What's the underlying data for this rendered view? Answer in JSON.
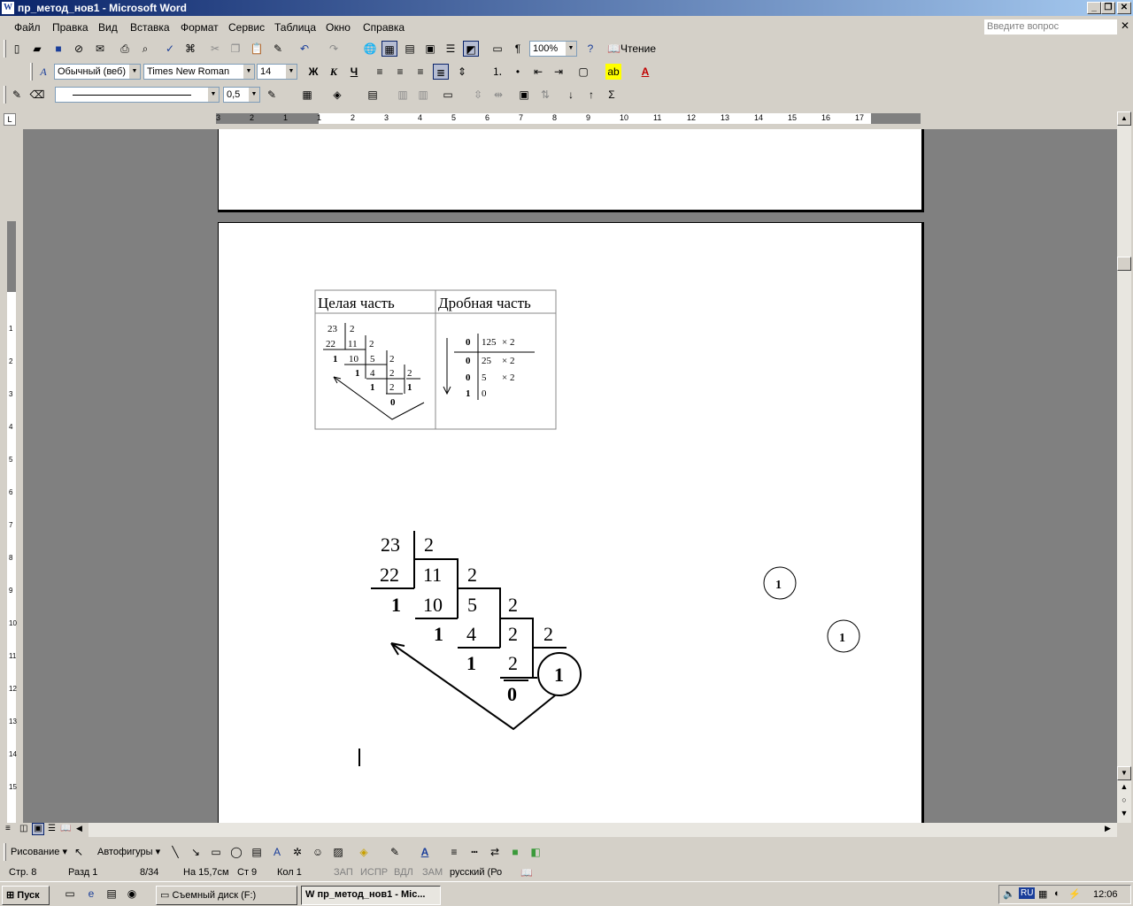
{
  "window": {
    "title": "пр_метод_нов1 - Microsoft Word",
    "app_icon": "W"
  },
  "menu": {
    "items": [
      "Файл",
      "Правка",
      "Вид",
      "Вставка",
      "Формат",
      "Сервис",
      "Таблица",
      "Окно",
      "Справка"
    ],
    "help_placeholder": "Введите вопрос"
  },
  "toolbar_standard": {
    "zoom": "100%",
    "reading_label": "Чтение"
  },
  "toolbar_formatting": {
    "style": "Обычный (веб)",
    "font": "Times New Roman",
    "size": "14",
    "bold": "Ж",
    "italic": "К",
    "underline": "Ч"
  },
  "toolbar_tables": {
    "line_weight": "0,5"
  },
  "ruler": {
    "labels": [
      "3",
      "2",
      "1",
      "1",
      "2",
      "3",
      "4",
      "5",
      "6",
      "7",
      "8",
      "9",
      "10",
      "11",
      "12",
      "13",
      "14",
      "15",
      "16",
      "17"
    ]
  },
  "table": {
    "header_left": "Целая часть",
    "header_right": "Дробная часть",
    "small_division": {
      "r1": [
        "23",
        "2"
      ],
      "r2": [
        "22",
        "11",
        "2"
      ],
      "r3": [
        "1",
        "10",
        "5",
        "2"
      ],
      "r4": [
        "1",
        "4",
        "2",
        "2"
      ],
      "r5": [
        "1",
        "2",
        "1"
      ],
      "r6": [
        "0"
      ]
    },
    "fraction": {
      "rows": [
        {
          "int": "0",
          "frac": "125",
          "mult": "× 2"
        },
        {
          "int": "0",
          "frac": "25",
          "mult": "× 2"
        },
        {
          "int": "0",
          "frac": "5",
          "mult": "× 2"
        },
        {
          "int": "1",
          "frac": "0",
          "mult": ""
        }
      ]
    }
  },
  "big_division": {
    "r1": [
      "23",
      "2"
    ],
    "r2": [
      "22",
      "11",
      "2"
    ],
    "r3": [
      "1",
      "10",
      "5",
      "2"
    ],
    "r4": [
      "1",
      "4",
      "2",
      "2"
    ],
    "r5": [
      "1",
      "2",
      "1"
    ],
    "r6": [
      "0"
    ],
    "floating_circle_a": "1",
    "floating_circle_b": "1"
  },
  "drawing_toolbar": {
    "draw_label": "Рисование",
    "autoshapes_label": "Автофигуры"
  },
  "status": {
    "page": "Стр. 8",
    "section": "Разд 1",
    "pages": "8/34",
    "at": "На 15,7см",
    "line": "Ст 9",
    "col": "Кол 1",
    "rec": "ЗАП",
    "trk": "ИСПР",
    "ext": "ВДЛ",
    "ovr": "ЗАМ",
    "lang": "русский (Ро"
  },
  "taskbar": {
    "start_label": "Пуск",
    "tasks": [
      "Съемный диск (F:)",
      "пр_метод_нов1 - Mic..."
    ],
    "lang_indicator": "RU",
    "clock": "12:06"
  }
}
